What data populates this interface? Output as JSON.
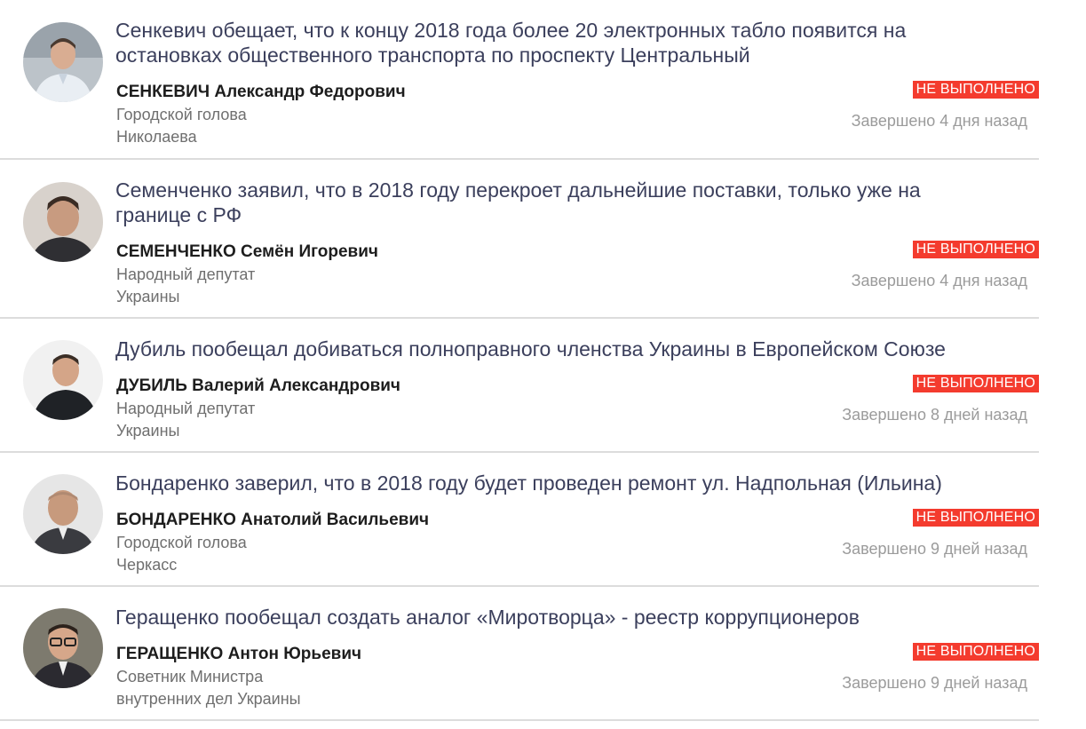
{
  "colors": {
    "badge": "#f43b2e",
    "title": "#3b3f5c",
    "divider": "#dcdcdc"
  },
  "items": [
    {
      "title": "Сенкевич обещает, что к концу 2018 года более 20 электронных табло появится на остановках общественного транспорта по проспекту Центральный",
      "surname": "СЕНКЕВИЧ",
      "given": "Александр Федорович",
      "role_line1": "Городской голова",
      "role_line2": "Николаева",
      "status": "НЕ ВЫПОЛНЕНО",
      "completed": "Завершено 4 дня назад"
    },
    {
      "title": "Семенченко заявил, что в 2018 году перекроет дальнейшие поставки, только уже на границе с РФ",
      "surname": "СЕМЕНЧЕНКО",
      "given": "Семён Игоревич",
      "role_line1": "Народный депутат",
      "role_line2": "Украины",
      "status": "НЕ ВЫПОЛНЕНО",
      "completed": "Завершено 4 дня назад"
    },
    {
      "title": "Дубиль пообещал добиваться полноправного членства Украины в Европейском Союзе",
      "surname": "ДУБИЛЬ",
      "given": "Валерий Александрович",
      "role_line1": "Народный депутат",
      "role_line2": "Украины",
      "status": "НЕ ВЫПОЛНЕНО",
      "completed": "Завершено 8 дней назад"
    },
    {
      "title": "Бондаренко заверил, что в 2018 году будет проведен ремонт ул. Надпольная (Ильина)",
      "surname": "БОНДАРЕНКО",
      "given": "Анатолий Васильевич",
      "role_line1": "Городской голова",
      "role_line2": "Черкасс",
      "status": "НЕ ВЫПОЛНЕНО",
      "completed": "Завершено 9 дней назад"
    },
    {
      "title": "Геращенко пообещал создать аналог «Миротворца» - реестр коррупционеров",
      "surname": "ГЕРАЩЕНКО",
      "given": "Антон Юрьевич",
      "role_line1": "Советник Министра",
      "role_line2": "внутренних дел Украины",
      "status": "НЕ ВЫПОЛНЕНО",
      "completed": "Завершено 9 дней назад"
    }
  ]
}
